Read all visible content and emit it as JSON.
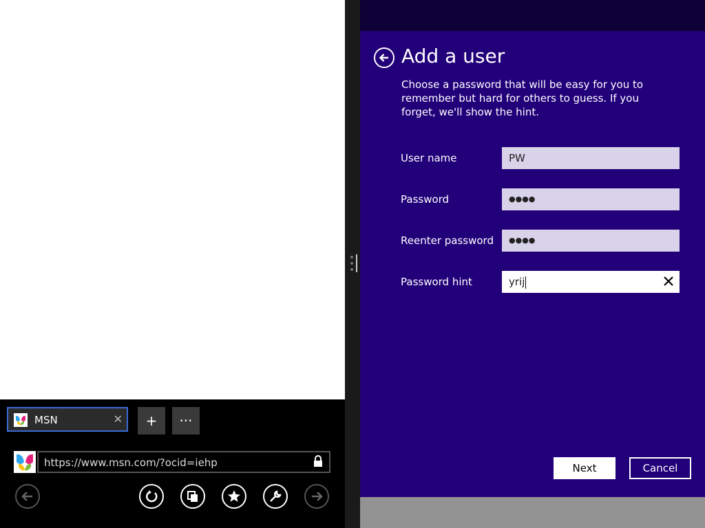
{
  "browser": {
    "tab": {
      "title": "MSN",
      "close_glyph": "✕"
    },
    "new_tab_glyph": "+",
    "more_glyph": "···",
    "address": "https://www.msn.com/?ocid=iehp",
    "icons": [
      "msn-butterfly-icon",
      "lock-icon",
      "back-arrow-icon",
      "refresh-icon",
      "tabs-icon",
      "favorites-star-icon",
      "tools-wrench-icon",
      "forward-arrow-icon"
    ]
  },
  "dialog": {
    "title": "Add a user",
    "description": "Choose a password that will be easy for you to remember but hard for others to guess. If you forget, we'll show the hint.",
    "fields": {
      "username_label": "User name",
      "username_value": "PW",
      "password_label": "Password",
      "password_value": "●●●●",
      "reenter_label": "Reenter password",
      "reenter_value": "●●●●",
      "hint_label": "Password hint",
      "hint_value": "yrij"
    },
    "next_label": "Next",
    "cancel_label": "Cancel"
  },
  "colors": {
    "dialog_bg": "#22007a",
    "dialog_top": "#100038",
    "field_bg": "#d9d3ea",
    "tab_border": "#3a6bd6"
  }
}
